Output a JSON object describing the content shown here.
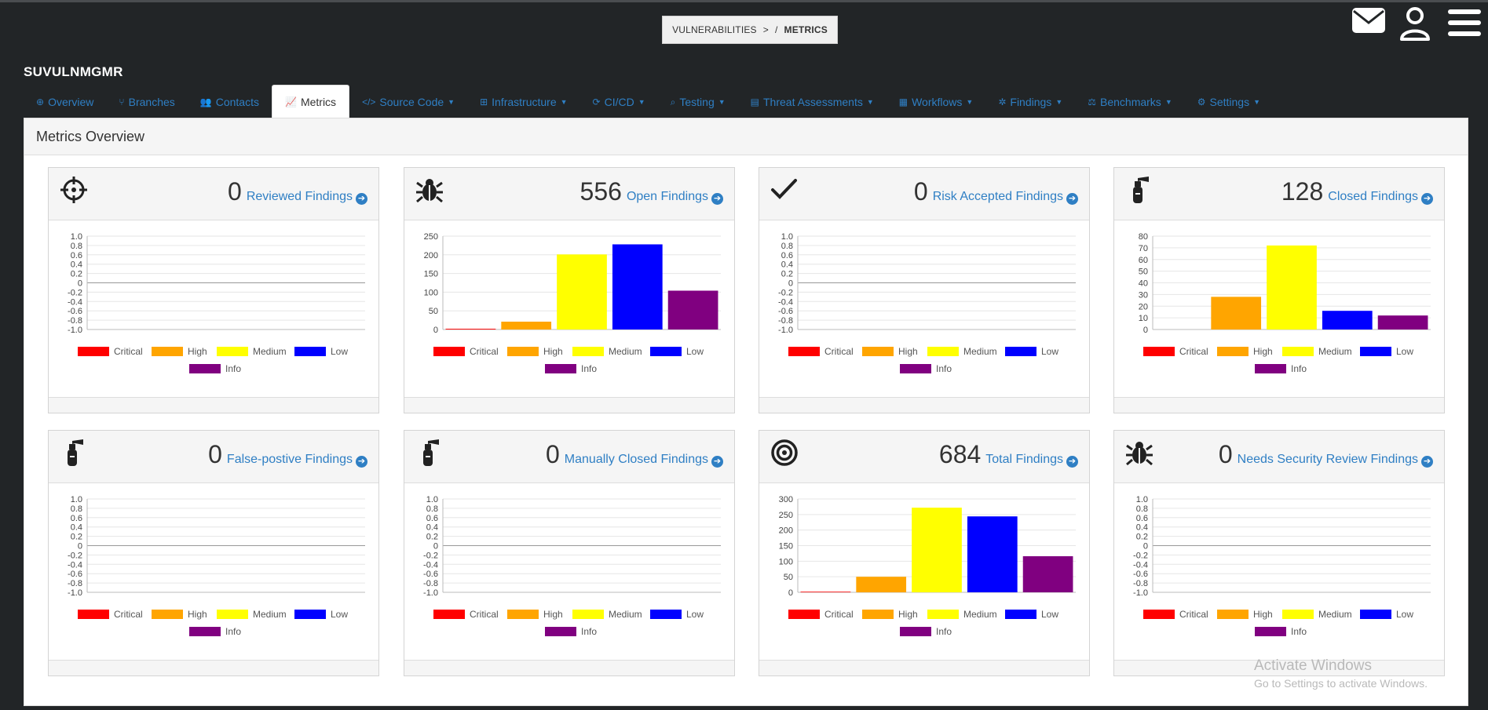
{
  "breadcrumb": {
    "parent": "VULNERABILITIES",
    "arrow": ">",
    "sep": "/",
    "current": "METRICS"
  },
  "app": {
    "name": "SUVULNMGMR"
  },
  "tabs": [
    {
      "label": "Overview",
      "icon": "globe-icon",
      "glyph": "⊕",
      "dropdown": false,
      "active": false
    },
    {
      "label": "Branches",
      "icon": "branch-icon",
      "glyph": "⑂",
      "dropdown": false,
      "active": false
    },
    {
      "label": "Contacts",
      "icon": "users-icon",
      "glyph": "👥",
      "dropdown": false,
      "active": false
    },
    {
      "label": "Metrics",
      "icon": "line-chart-icon",
      "glyph": "📈",
      "dropdown": false,
      "active": true
    },
    {
      "label": "Source Code",
      "icon": "code-icon",
      "glyph": "</>",
      "dropdown": true,
      "active": false
    },
    {
      "label": "Infrastructure",
      "icon": "sitemap-icon",
      "glyph": "⊞",
      "dropdown": true,
      "active": false
    },
    {
      "label": "CI/CD",
      "icon": "refresh-icon",
      "glyph": "⟳",
      "dropdown": true,
      "active": false
    },
    {
      "label": "Testing",
      "icon": "search-plus-icon",
      "glyph": "⌕",
      "dropdown": true,
      "active": false
    },
    {
      "label": "Threat Assessments",
      "icon": "file-icon",
      "glyph": "▤",
      "dropdown": true,
      "active": false
    },
    {
      "label": "Workflows",
      "icon": "calendar-icon",
      "glyph": "▦",
      "dropdown": true,
      "active": false
    },
    {
      "label": "Findings",
      "icon": "bug-icon",
      "glyph": "✲",
      "dropdown": true,
      "active": false
    },
    {
      "label": "Benchmarks",
      "icon": "balance-scale-icon",
      "glyph": "⚖",
      "dropdown": true,
      "active": false
    },
    {
      "label": "Settings",
      "icon": "cogs-icon",
      "glyph": "⚙",
      "dropdown": true,
      "active": false
    }
  ],
  "panel": {
    "title": "Metrics Overview"
  },
  "colors": {
    "Critical": "#ff0000",
    "High": "#ffa500",
    "Medium": "#ffff00",
    "Low": "#0000ff",
    "Info": "#800080",
    "link": "#2f7fc4"
  },
  "legend": [
    "Critical",
    "High",
    "Medium",
    "Low",
    "Info"
  ],
  "cards": [
    {
      "count": "0",
      "label": "Reviewed Findings",
      "icon": "crosshairs-icon"
    },
    {
      "count": "556",
      "label": "Open Findings",
      "icon": "bug-icon"
    },
    {
      "count": "0",
      "label": "Risk Accepted Findings",
      "icon": "check-icon"
    },
    {
      "count": "128",
      "label": "Closed Findings",
      "icon": "fire-extinguisher-icon"
    },
    {
      "count": "0",
      "label": "False-postive Findings",
      "icon": "fire-extinguisher-icon"
    },
    {
      "count": "0",
      "label": "Manually Closed Findings",
      "icon": "fire-extinguisher-icon"
    },
    {
      "count": "684",
      "label": "Total Findings",
      "icon": "bullseye-icon"
    },
    {
      "count": "0",
      "label": "Needs Security Review Findings",
      "icon": "bug-icon"
    }
  ],
  "chart_data": [
    {
      "type": "bar",
      "categories": [
        "Critical",
        "High",
        "Medium",
        "Low",
        "Info"
      ],
      "values": [
        0,
        0,
        0,
        0,
        0
      ],
      "ylim": [
        -1,
        1
      ],
      "yticks": [
        "1.0",
        "0.8",
        "0.6",
        "0.4",
        "0.2",
        "0",
        "-0.2",
        "-0.4",
        "-0.6",
        "-0.8",
        "-1.0"
      ],
      "legend": "bottom"
    },
    {
      "type": "bar",
      "categories": [
        "Critical",
        "High",
        "Medium",
        "Low",
        "Info"
      ],
      "values": [
        2,
        21,
        201,
        228,
        104
      ],
      "ylim": [
        0,
        250
      ],
      "yticks": [
        "250",
        "200",
        "150",
        "100",
        "50",
        "0"
      ],
      "legend": "bottom"
    },
    {
      "type": "bar",
      "categories": [
        "Critical",
        "High",
        "Medium",
        "Low",
        "Info"
      ],
      "values": [
        0,
        0,
        0,
        0,
        0
      ],
      "ylim": [
        -1,
        1
      ],
      "yticks": [
        "1.0",
        "0.8",
        "0.6",
        "0.4",
        "0.2",
        "0",
        "-0.2",
        "-0.4",
        "-0.6",
        "-0.8",
        "-1.0"
      ],
      "legend": "bottom"
    },
    {
      "type": "bar",
      "categories": [
        "Critical",
        "High",
        "Medium",
        "Low",
        "Info"
      ],
      "values": [
        0,
        28,
        72,
        16,
        12
      ],
      "ylim": [
        0,
        80
      ],
      "yticks": [
        "80",
        "70",
        "60",
        "50",
        "40",
        "30",
        "20",
        "10",
        "0"
      ],
      "legend": "bottom"
    },
    {
      "type": "bar",
      "categories": [
        "Critical",
        "High",
        "Medium",
        "Low",
        "Info"
      ],
      "values": [
        0,
        0,
        0,
        0,
        0
      ],
      "ylim": [
        -1,
        1
      ],
      "yticks": [
        "1.0",
        "0.8",
        "0.6",
        "0.4",
        "0.2",
        "0",
        "-0.2",
        "-0.4",
        "-0.6",
        "-0.8",
        "-1.0"
      ],
      "legend": "bottom"
    },
    {
      "type": "bar",
      "categories": [
        "Critical",
        "High",
        "Medium",
        "Low",
        "Info"
      ],
      "values": [
        0,
        0,
        0,
        0,
        0
      ],
      "ylim": [
        -1,
        1
      ],
      "yticks": [
        "1.0",
        "0.8",
        "0.6",
        "0.4",
        "0.2",
        "0",
        "-0.2",
        "-0.4",
        "-0.6",
        "-0.8",
        "-1.0"
      ],
      "legend": "bottom"
    },
    {
      "type": "bar",
      "categories": [
        "Critical",
        "High",
        "Medium",
        "Low",
        "Info"
      ],
      "values": [
        2,
        50,
        272,
        244,
        116
      ],
      "ylim": [
        0,
        300
      ],
      "yticks": [
        "300",
        "250",
        "200",
        "150",
        "100",
        "50",
        "0"
      ],
      "legend": "bottom"
    },
    {
      "type": "bar",
      "categories": [
        "Critical",
        "High",
        "Medium",
        "Low",
        "Info"
      ],
      "values": [
        0,
        0,
        0,
        0,
        0
      ],
      "ylim": [
        -1,
        1
      ],
      "yticks": [
        "1.0",
        "0.8",
        "0.6",
        "0.4",
        "0.2",
        "0",
        "-0.2",
        "-0.4",
        "-0.6",
        "-0.8",
        "-1.0"
      ],
      "legend": "bottom"
    }
  ],
  "watermark": {
    "line1": "Activate Windows",
    "line2": "Go to Settings to activate Windows."
  }
}
